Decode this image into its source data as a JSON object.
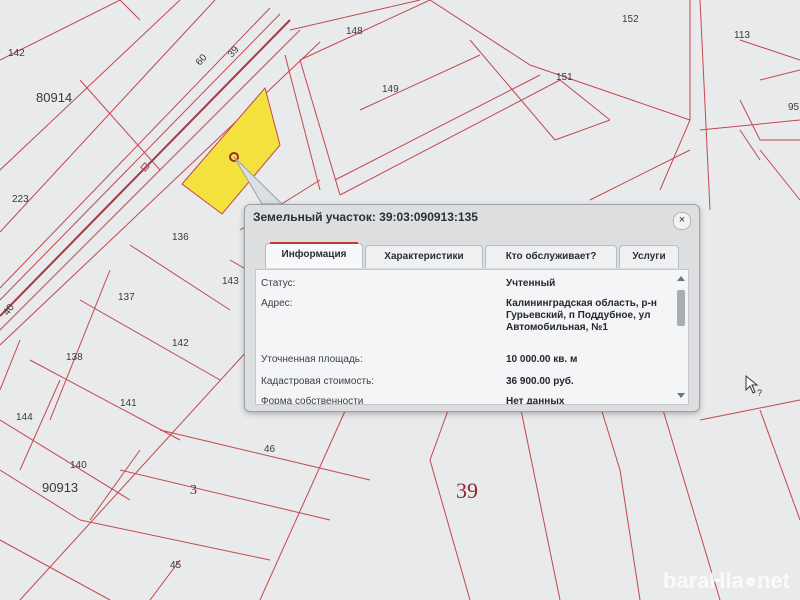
{
  "map": {
    "labels": {
      "l142a": "142",
      "l148": "148",
      "l152": "152",
      "l113": "113",
      "l60": "60",
      "l39s": "39",
      "l80914": "80914",
      "l149": "149",
      "l151": "151",
      "l95": "95",
      "l223": "223",
      "l136": "136",
      "l143": "143",
      "l137": "137",
      "l142b": "142",
      "l40": "40",
      "l138": "138",
      "l141": "141",
      "l144": "144",
      "l46": "46",
      "l140": "140",
      "l90913": "90913",
      "l3": "3",
      "l39big": "39",
      "l45": "45"
    },
    "colors": {
      "parcel_line": "#c4474f",
      "selected_parcel": "#f3e23d",
      "background": "#e9eaeb"
    }
  },
  "popup": {
    "title": "Земельный участок: 39:03:090913:135",
    "close_icon": "×",
    "tabs": [
      {
        "label": "Информация",
        "active": true
      },
      {
        "label": "Характеристики",
        "active": false
      },
      {
        "label": "Кто обслуживает?",
        "active": false
      },
      {
        "label": "Услуги",
        "active": false
      }
    ],
    "fields": [
      {
        "key": "Статус:",
        "value": "Учтенный"
      },
      {
        "key": "Адрес:",
        "value": "Калининградская область, р-н Гурьевский, п Поддубное, ул Автомобильная, №1"
      },
      {
        "key": "Уточненная площадь:",
        "value": "10 000.00 кв. м"
      },
      {
        "key": "Кадастровая стоимость:",
        "value": "36 900.00 руб."
      },
      {
        "key": "Форма собственности",
        "value": "Нет данных"
      }
    ]
  },
  "watermark": "baraHla●net"
}
